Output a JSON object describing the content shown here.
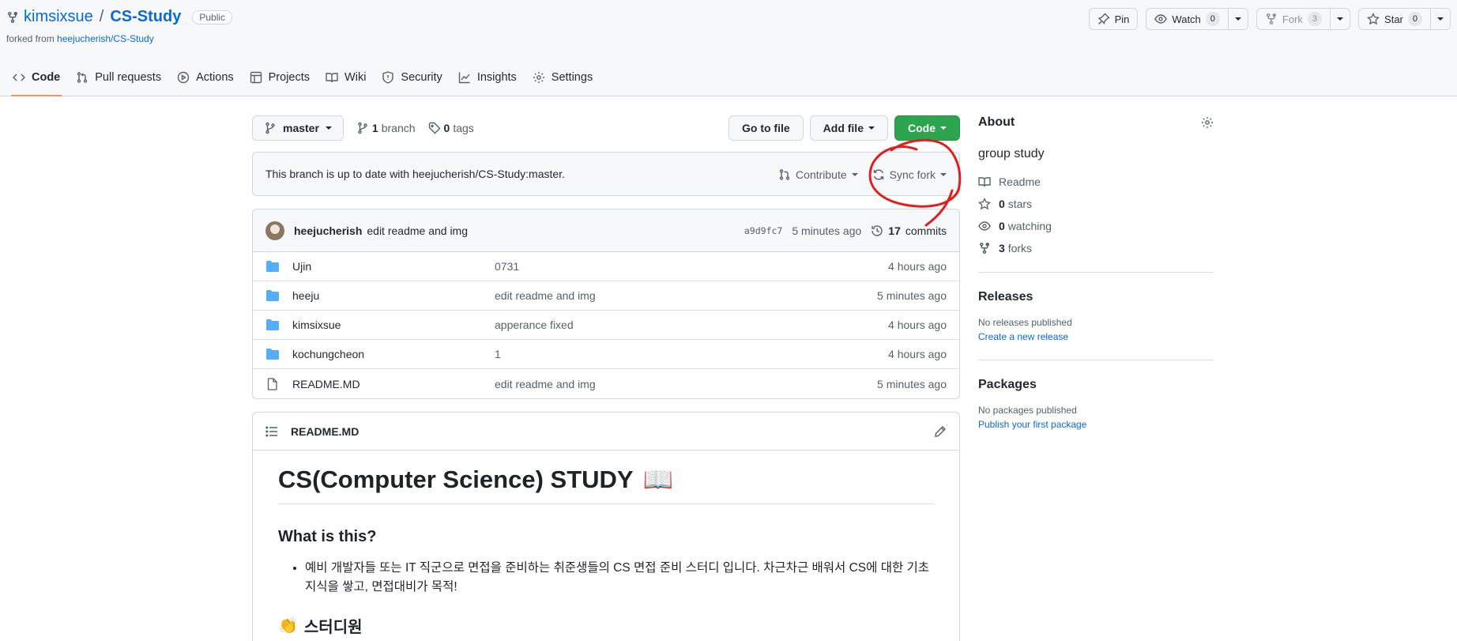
{
  "repo": {
    "owner": "kimsixsue",
    "separator": "/",
    "name": "CS-Study",
    "visibility": "Public",
    "forked_from_prefix": "forked from",
    "forked_from_link": "heejucherish/CS-Study"
  },
  "repo_actions": {
    "pin": "Pin",
    "watch": "Watch",
    "watch_count": "0",
    "fork": "Fork",
    "fork_count": "3",
    "star": "Star",
    "star_count": "0"
  },
  "tabs": [
    {
      "label": "Code",
      "icon": "code-icon",
      "active": true
    },
    {
      "label": "Pull requests",
      "icon": "pull-request-icon"
    },
    {
      "label": "Actions",
      "icon": "play-icon"
    },
    {
      "label": "Projects",
      "icon": "table-icon"
    },
    {
      "label": "Wiki",
      "icon": "book-icon"
    },
    {
      "label": "Security",
      "icon": "shield-icon"
    },
    {
      "label": "Insights",
      "icon": "graph-icon"
    },
    {
      "label": "Settings",
      "icon": "gear-icon"
    }
  ],
  "toolbar": {
    "branch": "master",
    "branch_count": "1",
    "branch_label": "branch",
    "tag_count": "0",
    "tag_label": "tags",
    "go_to_file": "Go to file",
    "add_file": "Add file",
    "code": "Code"
  },
  "sync": {
    "message": "This branch is up to date with heejucherish/CS-Study:master.",
    "contribute": "Contribute",
    "sync_fork": "Sync fork"
  },
  "latest_commit": {
    "author": "heejucherish",
    "message": "edit readme and img",
    "sha": "a9d9fc7",
    "age": "5 minutes ago",
    "commit_count": "17",
    "commit_label": "commits"
  },
  "files": [
    {
      "type": "folder",
      "name": "Ujin",
      "message": "0731",
      "age": "4 hours ago"
    },
    {
      "type": "folder",
      "name": "heeju",
      "message": "edit readme and img",
      "age": "5 minutes ago"
    },
    {
      "type": "folder",
      "name": "kimsixsue",
      "message": "apperance fixed",
      "age": "4 hours ago"
    },
    {
      "type": "folder",
      "name": "kochungcheon",
      "message": "1",
      "age": "4 hours ago"
    },
    {
      "type": "file",
      "name": "README.MD",
      "message": "edit readme and img",
      "age": "5 minutes ago"
    }
  ],
  "readme": {
    "filename": "README.MD",
    "h1": "CS(Computer Science) STUDY",
    "h1_emoji": "📖",
    "h2": "What is this?",
    "bullet": "예비 개발자들 또는 IT 직군으로 면접을 준비하는 취준생들의 CS 면접 준비 스터디 입니다. 차근차근 배워서 CS에 대한 기초 지식을 쌓고, 면접대비가 목적!",
    "h3_emoji": "👏",
    "h3": "스터디원"
  },
  "about": {
    "title": "About",
    "description": "group study",
    "readme": "Readme",
    "stars_count": "0",
    "stars_label": "stars",
    "watching_count": "0",
    "watching_label": "watching",
    "forks_count": "3",
    "forks_label": "forks"
  },
  "releases": {
    "title": "Releases",
    "none": "No releases published",
    "create": "Create a new release"
  },
  "packages": {
    "title": "Packages",
    "none": "No packages published",
    "publish": "Publish your first package"
  },
  "colors": {
    "accent_link": "#0969da",
    "primary_button": "#2da44e",
    "tab_underline": "#fd8c73",
    "folder": "#54aeff",
    "annotation": "#e11d1d"
  }
}
